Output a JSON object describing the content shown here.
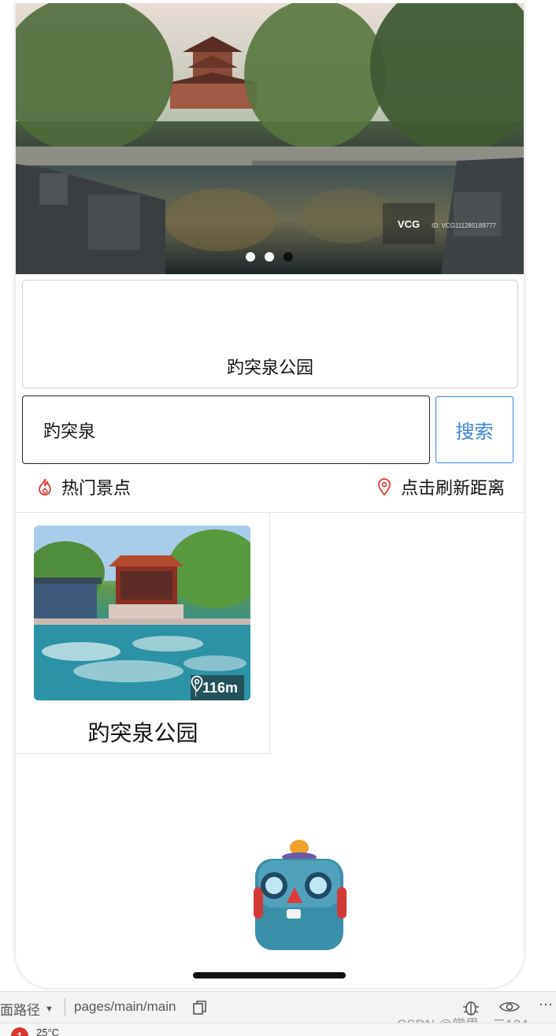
{
  "banner": {
    "watermark_brand": "VCG",
    "watermark_id": "ID: VCG111285189777",
    "carousel": {
      "count": 3,
      "active_index": 2
    }
  },
  "name_card": {
    "title": "趵突泉公园"
  },
  "search": {
    "value": "趵突泉",
    "button_label": "搜索"
  },
  "section": {
    "hot_label": "热门景点",
    "refresh_label": "点击刷新距离"
  },
  "spots": [
    {
      "name": "趵突泉公园",
      "distance": "116m"
    }
  ],
  "devtools": {
    "path_label": "面路径",
    "path_value": "pages/main/main",
    "watermark": "CSDN @常思一二124"
  },
  "status": {
    "error_count": "1",
    "temperature": "25°C"
  },
  "colors": {
    "accent_blue": "#3a86d6",
    "hot_red": "#e03b30",
    "dot_active": "#111111"
  }
}
